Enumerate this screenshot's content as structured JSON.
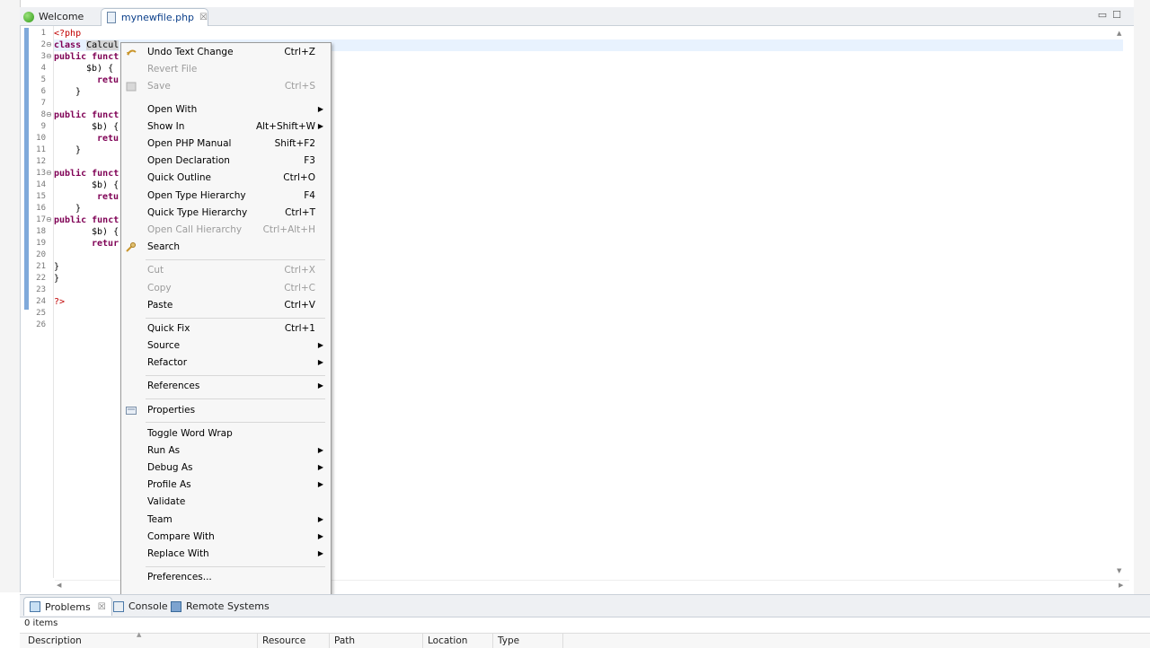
{
  "editor_tabs": [
    {
      "label": "Welcome",
      "active": false
    },
    {
      "label": "mynewfile.php",
      "active": true
    }
  ],
  "line_numbers": [
    "1",
    "2",
    "3",
    "4",
    "5",
    "6",
    "7",
    "8",
    "9",
    "10",
    "11",
    "12",
    "13",
    "14",
    "15",
    "16",
    "17",
    "18",
    "19",
    "20",
    "21",
    "22",
    "23",
    "24",
    "25",
    "26"
  ],
  "code": {
    "l1": "<?php",
    "l2a": "class ",
    "l2b": "Calcul",
    "l3a": "public",
    "l3b": " funct",
    "l4": "$b) {",
    "l5": "retu",
    "l6": "}",
    "l8a": "public",
    "l8b": " funct",
    "l9": "$b) {",
    "l10": "retu",
    "l11": "}",
    "l13a": "public",
    "l13b": " funct",
    "l14": "$b) {",
    "l15": "retu",
    "l16": "}",
    "l17a": "public",
    "l17b": " funct",
    "l18": "$b) {",
    "l19": "retur",
    "l21": "}",
    "l22": "}",
    "l24": "?>"
  },
  "context_menu": {
    "items": [
      {
        "label": "Undo Text Change",
        "shortcut": "Ctrl+Z",
        "enabled": true,
        "icon": "undo-icon"
      },
      {
        "label": "Revert File",
        "shortcut": "",
        "enabled": false
      },
      {
        "label": "Save",
        "shortcut": "Ctrl+S",
        "enabled": false,
        "icon": "save-icon"
      },
      {
        "label": "Open With",
        "shortcut": "",
        "enabled": true,
        "submenu": true
      },
      {
        "label": "Show In",
        "shortcut": "Alt+Shift+W",
        "enabled": true,
        "submenu": true
      },
      {
        "label": "Open PHP Manual",
        "shortcut": "Shift+F2",
        "enabled": true
      },
      {
        "label": "Open Declaration",
        "shortcut": "F3",
        "enabled": true
      },
      {
        "label": "Quick Outline",
        "shortcut": "Ctrl+O",
        "enabled": true
      },
      {
        "label": "Open Type Hierarchy",
        "shortcut": "F4",
        "enabled": true
      },
      {
        "label": "Quick Type Hierarchy",
        "shortcut": "Ctrl+T",
        "enabled": true
      },
      {
        "label": "Open Call Hierarchy",
        "shortcut": "Ctrl+Alt+H",
        "enabled": false
      },
      {
        "label": "Search",
        "shortcut": "",
        "enabled": true,
        "icon": "search-icon"
      },
      {
        "label": "Cut",
        "shortcut": "Ctrl+X",
        "enabled": false
      },
      {
        "label": "Copy",
        "shortcut": "Ctrl+C",
        "enabled": false
      },
      {
        "label": "Paste",
        "shortcut": "Ctrl+V",
        "enabled": true
      },
      {
        "label": "Quick Fix",
        "shortcut": "Ctrl+1",
        "enabled": true
      },
      {
        "label": "Source",
        "shortcut": "",
        "enabled": true,
        "submenu": true
      },
      {
        "label": "Refactor",
        "shortcut": "",
        "enabled": true,
        "submenu": true
      },
      {
        "label": "References",
        "shortcut": "",
        "enabled": true,
        "submenu": true
      },
      {
        "label": "Properties",
        "shortcut": "",
        "enabled": true,
        "icon": "properties-icon"
      },
      {
        "label": "Toggle Word Wrap",
        "shortcut": "",
        "enabled": true
      },
      {
        "label": "Run As",
        "shortcut": "",
        "enabled": true,
        "submenu": true
      },
      {
        "label": "Debug As",
        "shortcut": "",
        "enabled": true,
        "submenu": true
      },
      {
        "label": "Profile As",
        "shortcut": "",
        "enabled": true,
        "submenu": true
      },
      {
        "label": "Validate",
        "shortcut": "",
        "enabled": true
      },
      {
        "label": "Team",
        "shortcut": "",
        "enabled": true,
        "submenu": true
      },
      {
        "label": "Compare With",
        "shortcut": "",
        "enabled": true,
        "submenu": true
      },
      {
        "label": "Replace With",
        "shortcut": "",
        "enabled": true,
        "submenu": true
      },
      {
        "label": "Preferences...",
        "shortcut": "",
        "enabled": true
      }
    ]
  },
  "bottom_panel": {
    "tabs": [
      {
        "label": "Problems",
        "active": true
      },
      {
        "label": "Console",
        "active": false
      },
      {
        "label": "Remote Systems",
        "active": false
      }
    ],
    "item_count": "0 items",
    "columns": [
      "Description",
      "Resource",
      "Path",
      "Location",
      "Type"
    ]
  },
  "colors": {
    "keyword": "#7f0055",
    "php_tag": "#c10000",
    "current_line": "#e8f2fe",
    "disabled_text": "#9c9c9c"
  }
}
